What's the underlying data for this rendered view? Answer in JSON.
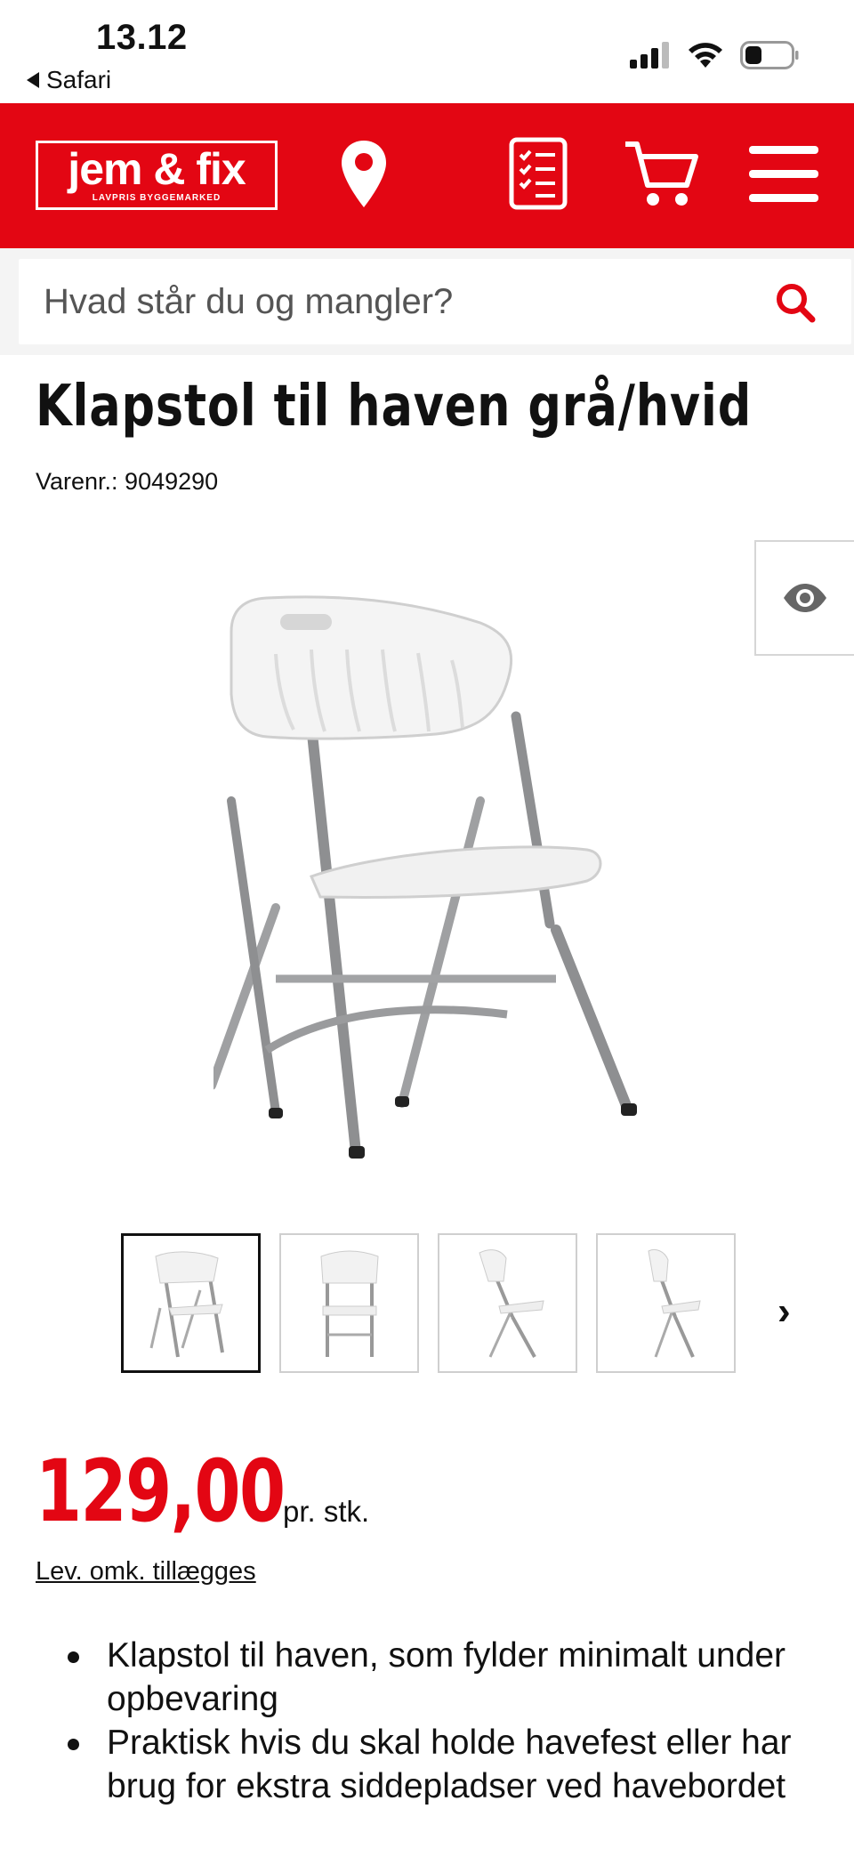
{
  "status_bar": {
    "time": "13.12",
    "back_app": "Safari"
  },
  "header": {
    "logo_text": "jem & fix",
    "logo_tagline": "LAVPRIS BYGGEMARKED",
    "brand_color": "#e30613",
    "icons": [
      "location-pin-icon",
      "list-icon",
      "cart-icon",
      "menu-icon"
    ]
  },
  "search": {
    "placeholder": "Hvad står du og mangler?"
  },
  "product": {
    "title": "Klapstol til haven grå/hvid",
    "item_number": "Varenr.: 9049290",
    "price": "129,00",
    "price_unit": "pr. stk.",
    "delivery_note": "Lev. omk. tillægges",
    "features": [
      "Klapstol til haven, som fylder minimalt under opbevaring",
      "Praktisk hvis du skal holde havefest eller har brug for ekstra siddepladser ved havebordet"
    ],
    "thumbnail_count": 4,
    "active_thumbnail": 1
  }
}
